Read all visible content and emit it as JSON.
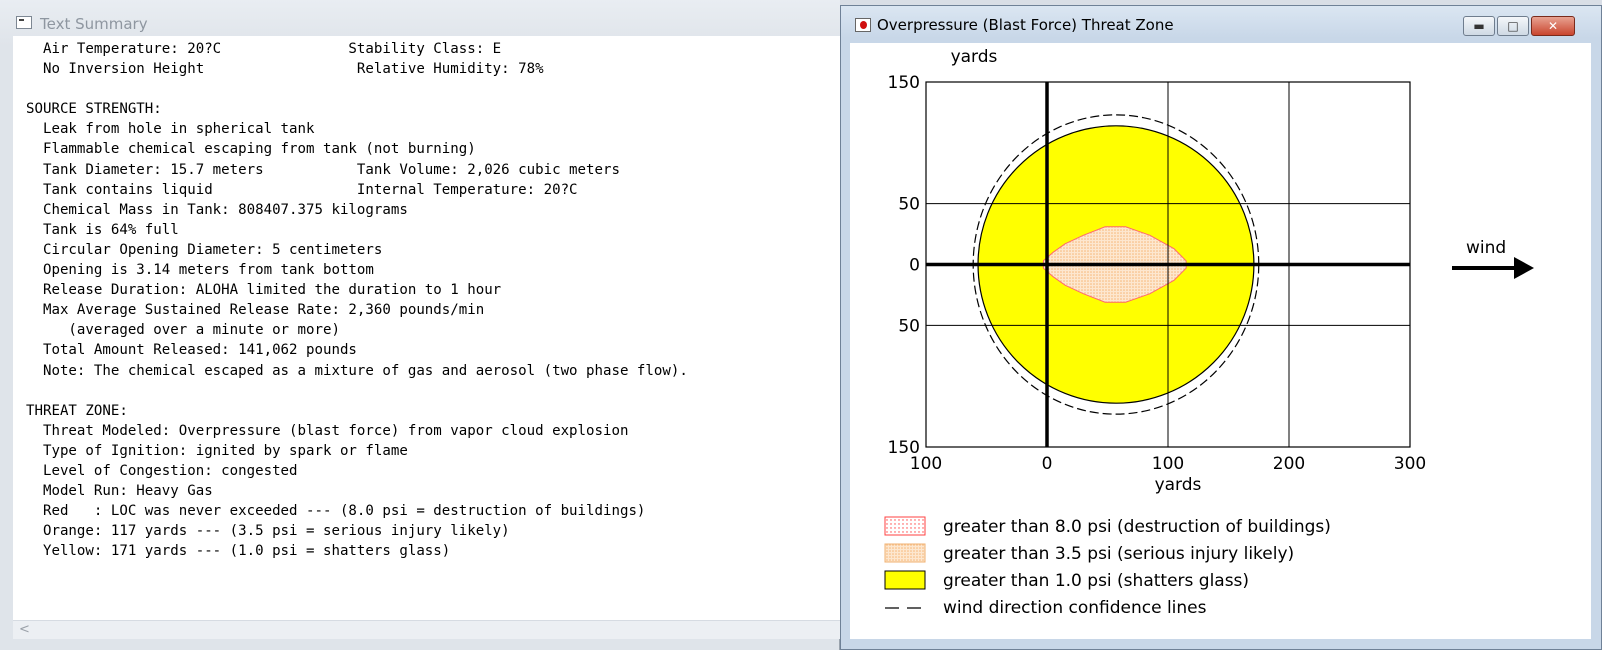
{
  "left_window": {
    "title": "Text Summary",
    "lines": [
      "  Air Temperature: 20?C               Stability Class: E",
      "  No Inversion Height                  Relative Humidity: 78%",
      "",
      "SOURCE STRENGTH:",
      "  Leak from hole in spherical tank",
      "  Flammable chemical escaping from tank (not burning)",
      "  Tank Diameter: 15.7 meters           Tank Volume: 2,026 cubic meters",
      "  Tank contains liquid                 Internal Temperature: 20?C",
      "  Chemical Mass in Tank: 808407.375 kilograms",
      "  Tank is 64% full",
      "  Circular Opening Diameter: 5 centimeters",
      "  Opening is 3.14 meters from tank bottom",
      "  Release Duration: ALOHA limited the duration to 1 hour",
      "  Max Average Sustained Release Rate: 2,360 pounds/min",
      "     (averaged over a minute or more)",
      "  Total Amount Released: 141,062 pounds",
      "  Note: The chemical escaped as a mixture of gas and aerosol (two phase flow).",
      "",
      "THREAT ZONE:",
      "  Threat Modeled: Overpressure (blast force) from vapor cloud explosion",
      "  Type of Ignition: ignited by spark or flame",
      "  Level of Congestion: congested",
      "  Model Run: Heavy Gas",
      "  Red   : LOC was never exceeded --- (8.0 psi = destruction of buildings)",
      "  Orange: 117 yards --- (3.5 psi = serious injury likely)",
      "  Yellow: 171 yards --- (1.0 psi = shatters glass)"
    ],
    "scroll_left_icon": "chevron-left-icon"
  },
  "right_window": {
    "title": "Overpressure (Blast Force) Threat Zone",
    "controls": {
      "minimize": "minimize-icon",
      "maximize": "maximize-icon",
      "close": "close-icon"
    },
    "wind_label": "wind",
    "colors": {
      "red": "#ff4040",
      "orange": "#fbd2a8",
      "yellow": "#ffff00",
      "orange_stroke": "#ff6a6a"
    }
  },
  "chart_data": {
    "type": "area",
    "xlabel": "yards",
    "ylabel": "yards",
    "xlim": [
      -100,
      300
    ],
    "ylim": [
      -150,
      150
    ],
    "x_ticks": [
      {
        "v": -100,
        "label": "100"
      },
      {
        "v": 0,
        "label": "0"
      },
      {
        "v": 100,
        "label": "100"
      },
      {
        "v": 200,
        "label": "200"
      },
      {
        "v": 300,
        "label": "300"
      }
    ],
    "y_ticks": [
      {
        "v": 150,
        "label": "150"
      },
      {
        "v": 50,
        "label": "50"
      },
      {
        "v": 0,
        "label": "0"
      },
      {
        "v": -50,
        "label": "50"
      },
      {
        "v": -150,
        "label": "150"
      }
    ],
    "grid": true,
    "zones": {
      "yellow": {
        "cx": 57,
        "cy": 0,
        "rx": 114,
        "ry": 114
      },
      "orange": [
        [
          -3,
          3
        ],
        [
          5,
          10
        ],
        [
          15,
          17
        ],
        [
          30,
          24
        ],
        [
          48,
          31
        ],
        [
          65,
          31
        ],
        [
          85,
          24
        ],
        [
          105,
          13
        ],
        [
          115,
          3
        ],
        [
          115,
          -3
        ],
        [
          105,
          -13
        ],
        [
          85,
          -24
        ],
        [
          65,
          -31
        ],
        [
          48,
          -31
        ],
        [
          30,
          -24
        ],
        [
          15,
          -17
        ],
        [
          5,
          -10
        ],
        [
          -3,
          -3
        ]
      ],
      "confidence": {
        "cx": 57,
        "cy": 0,
        "rx": 118,
        "ry": 123
      }
    },
    "legend": [
      {
        "label": "greater than 8.0 psi (destruction of buildings)",
        "style": "red-dotted"
      },
      {
        "label": "greater than 3.5 psi (serious injury likely)",
        "style": "orange-dotted"
      },
      {
        "label": "greater than 1.0 psi (shatters glass)",
        "style": "yellow-fill"
      },
      {
        "label": "wind direction confidence lines",
        "style": "dashed"
      }
    ],
    "legend_position": "bottom-left"
  }
}
